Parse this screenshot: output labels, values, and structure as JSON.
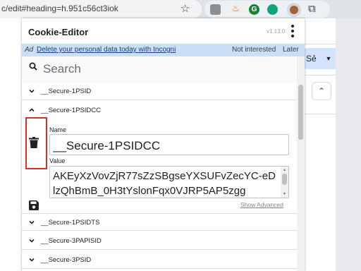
{
  "browser": {
    "url": "c/edit#heading=h.951c56ct3iok",
    "icons": [
      "star-icon",
      "ext-profile-icon",
      "ext-fire-icon",
      "ext-grammarly-icon",
      "ext-chatgpt-icon",
      "ext-cookie-icon",
      "extensions-puzzle-icon"
    ],
    "ext_grammarly_glyph": "G"
  },
  "background_page": {
    "share_label": "Sẻ"
  },
  "popup": {
    "title": "Cookie-Editor",
    "version": "v1.13.0",
    "ad": {
      "tag": "Ad",
      "link_text": "Delete your personal data today with Incogni",
      "not_interested": "Not interested",
      "later": "Later"
    },
    "search": {
      "placeholder": "Search"
    },
    "cookies": [
      {
        "name": "__Secure-1PSID",
        "expanded": false
      },
      {
        "name": "__Secure-1PSIDCC",
        "expanded": true
      },
      {
        "name": "__Secure-1PSIDTS",
        "expanded": false
      },
      {
        "name": "__Secure-3PAPISID",
        "expanded": false
      },
      {
        "name": "__Secure-3PSID",
        "expanded": false
      }
    ],
    "editor": {
      "name_label": "Name",
      "name_value": "__Secure-1PSIDCC",
      "value_label": "Value",
      "value_value": "AKEyXzVovZjR77sZzSBgseYXSUFvZecYC-eDlzQhBmB_0H3tYslonFqx0VJRP5AP5zgg",
      "show_advanced": "Show Advanced"
    }
  },
  "colors": {
    "ad_bg": "#c9dff5",
    "highlight_box": "#d93025",
    "share_button": "#d3e3fd"
  }
}
